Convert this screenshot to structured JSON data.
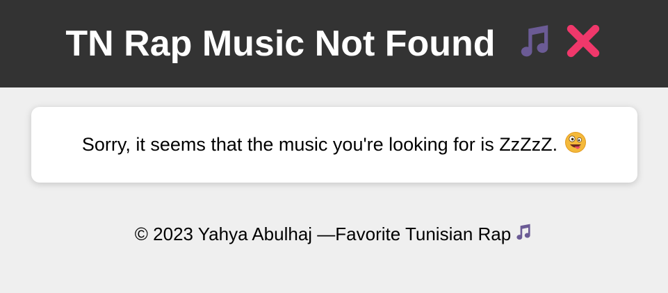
{
  "header": {
    "title": "TN Rap Music Not Found",
    "icons": [
      "musical-note-icon",
      "red-cross-icon"
    ]
  },
  "card": {
    "message": "Sorry, it seems that the music you're looking for is ZzZzZ.",
    "emoji": "zany-face-icon"
  },
  "footer": {
    "text": "© 2023 Yahya Abulhaj —Favorite Tunisian Rap",
    "icon": "musical-note-icon"
  },
  "colors": {
    "header_bg": "#333333",
    "page_bg": "#efefef",
    "card_bg": "#ffffff",
    "note": "#6b5b95",
    "cross": "#f0386b",
    "emoji_face": "#f4b93b"
  }
}
